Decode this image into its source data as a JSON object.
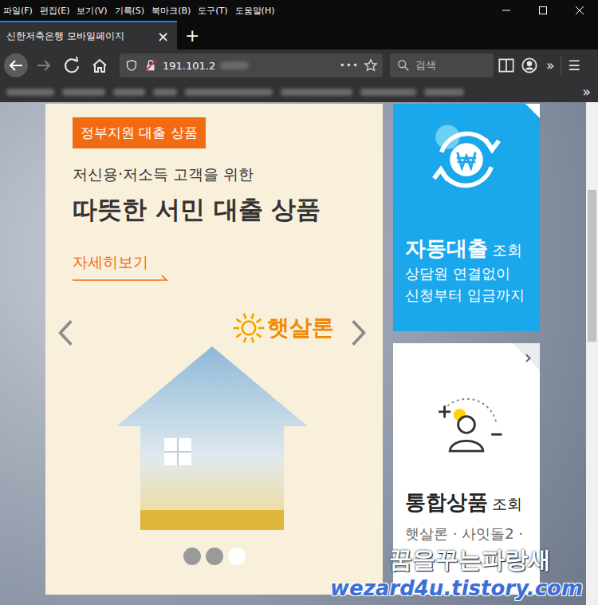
{
  "window": {
    "menu": [
      "파일(F)",
      "편집(E)",
      "보기(V)",
      "기록(S)",
      "북마크(B)",
      "도구(T)",
      "도움말(H)"
    ]
  },
  "tabs": [
    {
      "label": "신한저축은행 모바일페이지",
      "selected": true,
      "close": "×"
    }
  ],
  "new_tab": "+",
  "toolbar": {
    "url": "191.101.2",
    "page_actions": "•••",
    "search_placeholder": "검색",
    "overflow": "»",
    "menu": "☰"
  },
  "bookmarks": {
    "overflow": "»"
  },
  "banner": {
    "badge": "정부지원 대출 상품",
    "subtitle": "저신용·저소득 고객을 위한",
    "title": "따뜻한 서민 대출 상품",
    "link": "자세히보기",
    "logo": "햇살론",
    "slides": [
      {
        "selected": false
      },
      {
        "selected": false
      },
      {
        "selected": true
      }
    ]
  },
  "cards": [
    {
      "kind": "blue",
      "title": "자동대출",
      "suffix": "조회",
      "lines": [
        "상담원 연결없이",
        "신청부터 입금까지"
      ],
      "chevron": ""
    },
    {
      "kind": "white",
      "title": "통합상품",
      "suffix": "조회",
      "lines": [
        "햇살론 · 사잇돌2 ·"
      ],
      "chevron": "›"
    }
  ],
  "watermark": {
    "lines": [
      "꿈을꾸는파랑새",
      "wezard4u.tistory.com"
    ]
  }
}
